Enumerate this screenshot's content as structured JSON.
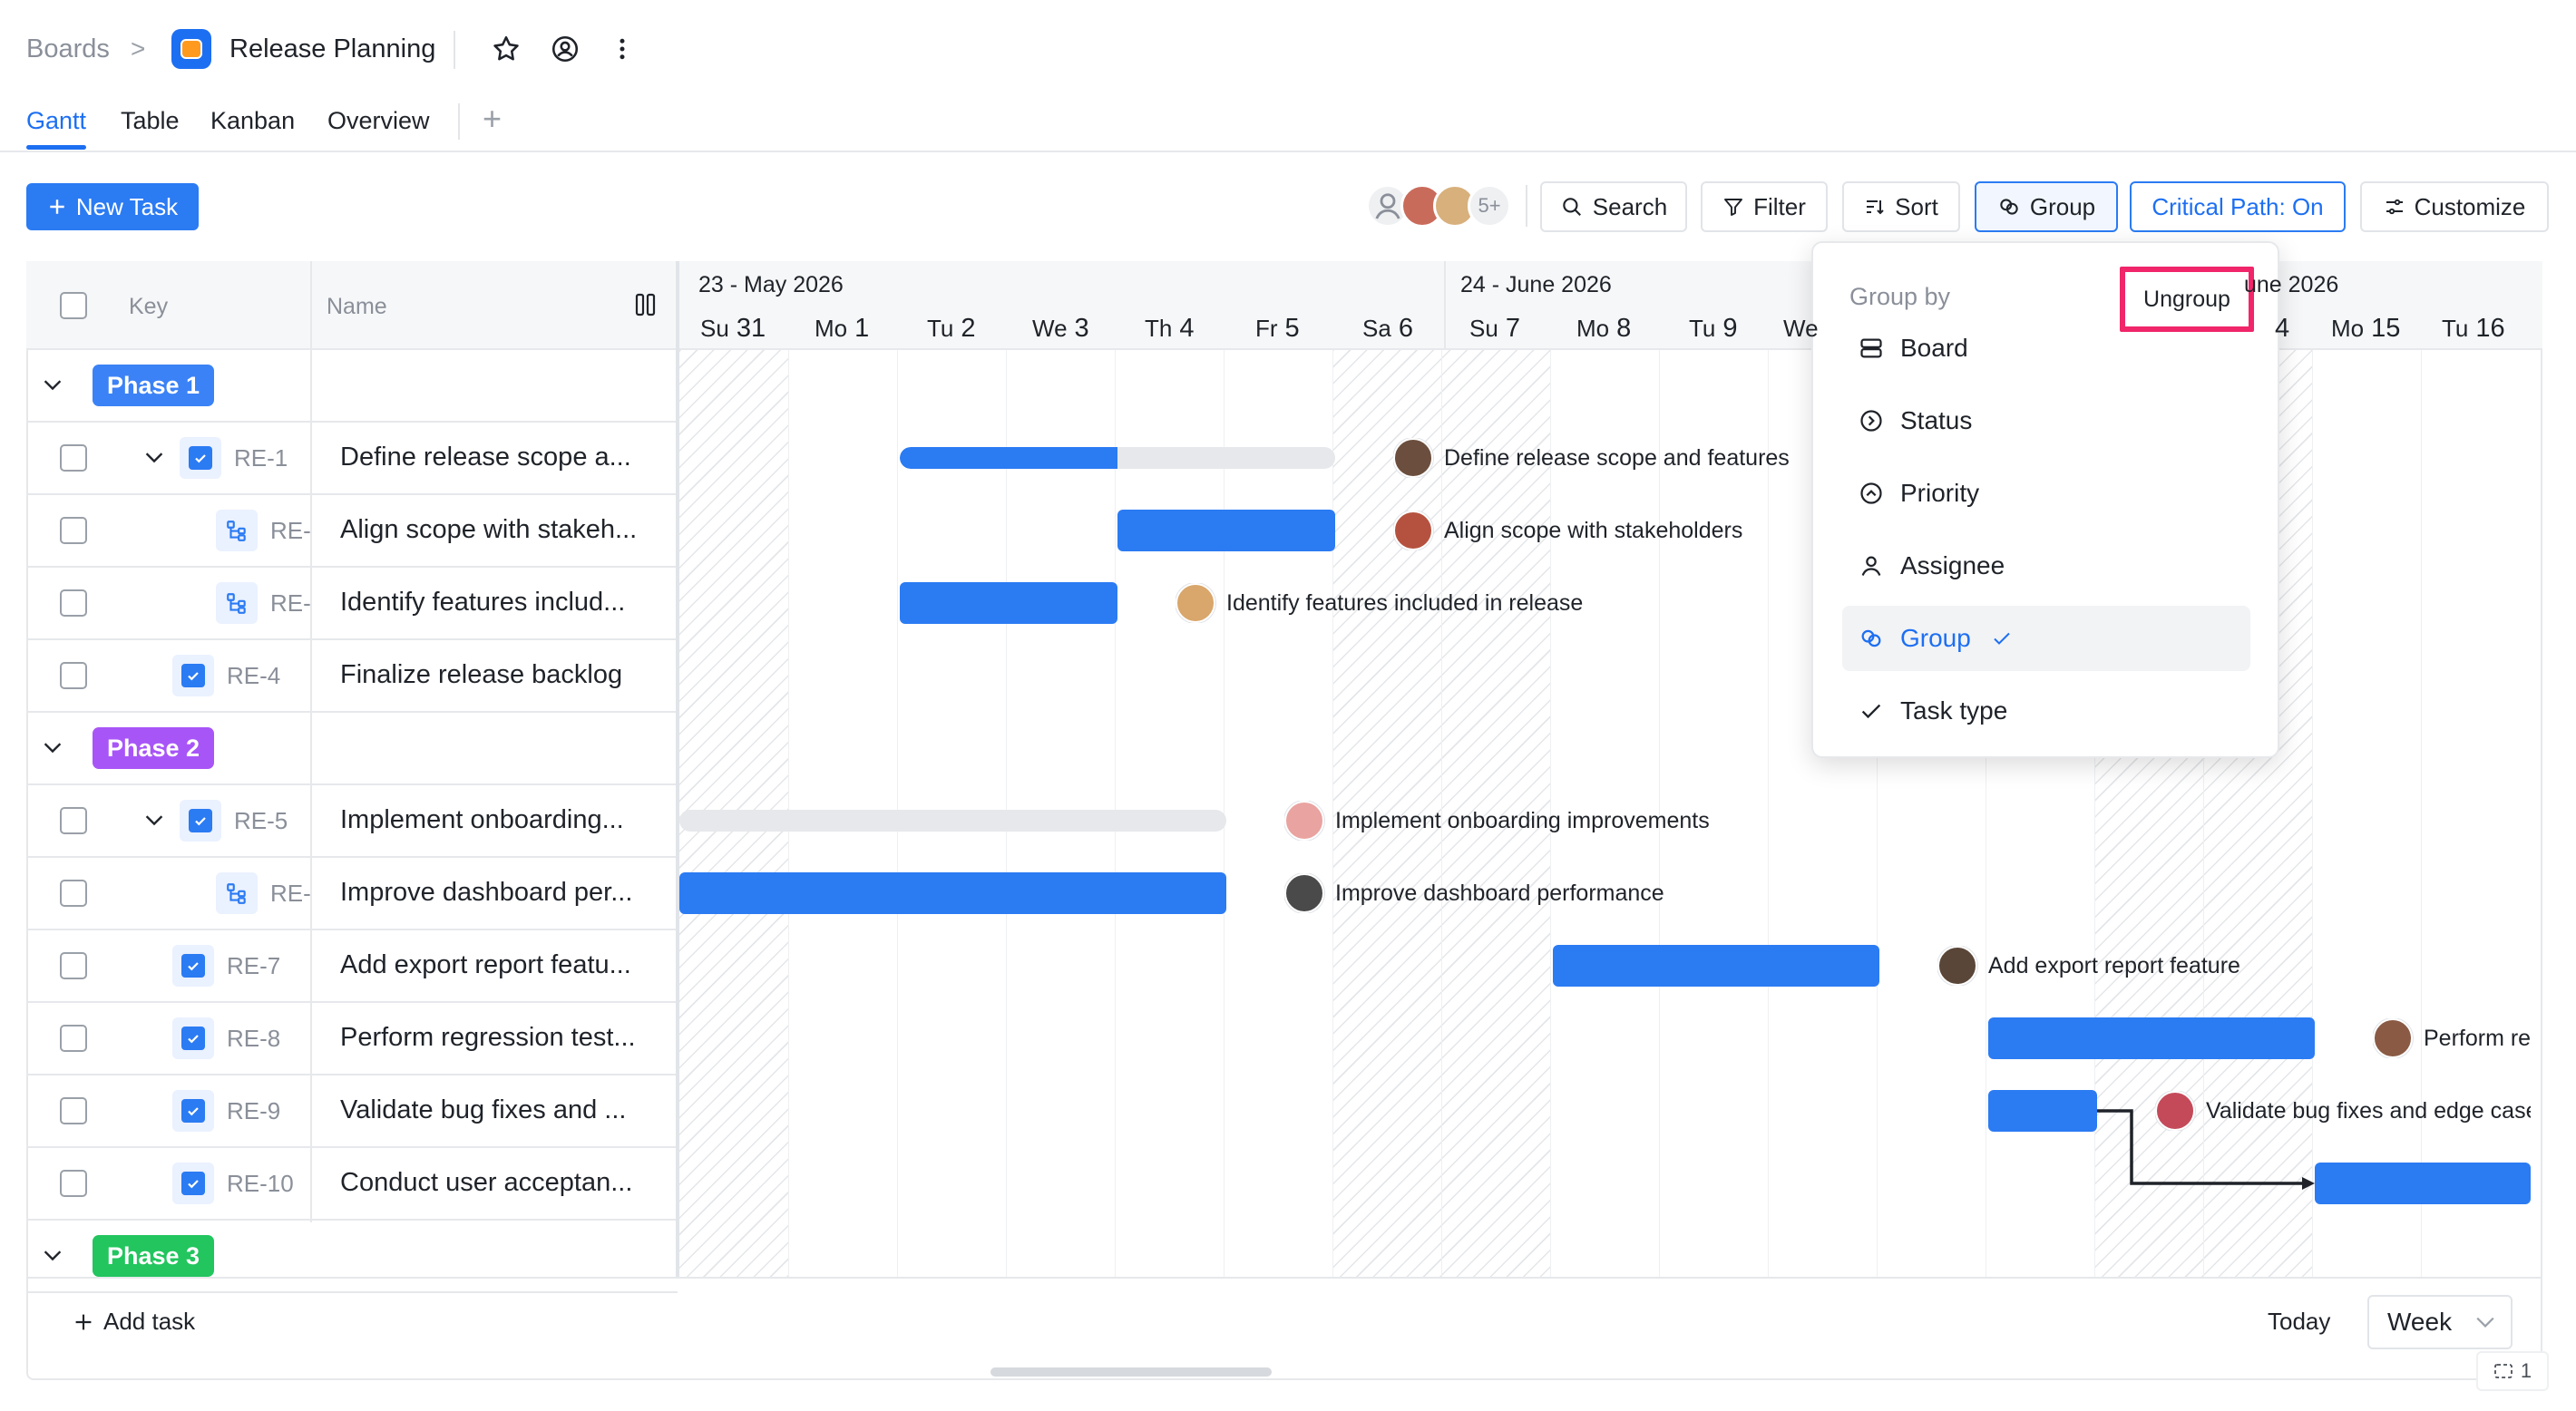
{
  "breadcrumb": {
    "root": "Boards",
    "separator": ">",
    "board_title": "Release Planning"
  },
  "tabs": [
    {
      "label": "Gantt",
      "active": true
    },
    {
      "label": "Table",
      "active": false
    },
    {
      "label": "Kanban",
      "active": false
    },
    {
      "label": "Overview",
      "active": false
    }
  ],
  "toolbar": {
    "new_task_label": "New Task",
    "avatars_more": "5+",
    "search_label": "Search",
    "filter_label": "Filter",
    "sort_label": "Sort",
    "group_label": "Group",
    "critical_path_label": "Critical Path: On",
    "customize_label": "Customize"
  },
  "table_header": {
    "key": "Key",
    "name": "Name"
  },
  "phases": [
    {
      "label": "Phase 1",
      "color": "#3b82f6"
    },
    {
      "label": "Phase 2",
      "color": "#a855f7"
    },
    {
      "label": "Phase 3",
      "color": "#22c55e"
    }
  ],
  "rows": [
    {
      "key": "RE-1",
      "name": "Define release scope a...",
      "bar_label": "Define release scope and features"
    },
    {
      "key": "RE-",
      "name": "Align scope with stakeh...",
      "bar_label": "Align scope with stakeholders"
    },
    {
      "key": "RE-",
      "name": "Identify features includ...",
      "bar_label": "Identify features included in release"
    },
    {
      "key": "RE-4",
      "name": "Finalize release backlog",
      "bar_label": ""
    },
    {
      "key": "RE-5",
      "name": "Implement onboarding...",
      "bar_label": "Implement onboarding improvements"
    },
    {
      "key": "RE-",
      "name": "Improve dashboard per...",
      "bar_label": "Improve dashboard performance"
    },
    {
      "key": "RE-7",
      "name": "Add export report featu...",
      "bar_label": "Add export report feature"
    },
    {
      "key": "RE-8",
      "name": "Perform regression test...",
      "bar_label": "Perform re"
    },
    {
      "key": "RE-9",
      "name": "Validate bug fixes and ...",
      "bar_label": "Validate bug fixes and edge case"
    },
    {
      "key": "RE-10",
      "name": "Conduct user acceptan...",
      "bar_label": ""
    }
  ],
  "timeline": {
    "weeks": [
      "23 - May 2026",
      "24 - June 2026",
      "une 2026"
    ],
    "days": [
      {
        "dow": "Su",
        "num": "31"
      },
      {
        "dow": "Mo",
        "num": "1"
      },
      {
        "dow": "Tu",
        "num": "2"
      },
      {
        "dow": "We",
        "num": "3"
      },
      {
        "dow": "Th",
        "num": "4"
      },
      {
        "dow": "Fr",
        "num": "5"
      },
      {
        "dow": "Sa",
        "num": "6"
      },
      {
        "dow": "Su",
        "num": "7"
      },
      {
        "dow": "Mo",
        "num": "8"
      },
      {
        "dow": "Tu",
        "num": "9"
      },
      {
        "dow": "We",
        "num": ""
      },
      {
        "dow": "",
        "num": "4"
      },
      {
        "dow": "Mo",
        "num": "15"
      },
      {
        "dow": "Tu",
        "num": "16"
      }
    ]
  },
  "footer": {
    "add_task": "Add task",
    "today": "Today",
    "zoom": "Week",
    "fit_count": "1"
  },
  "group_dropdown": {
    "title": "Group by",
    "ungroup": "Ungroup",
    "options": [
      {
        "label": "Board",
        "icon": "board-icon",
        "selected": false
      },
      {
        "label": "Status",
        "icon": "status-icon",
        "selected": false
      },
      {
        "label": "Priority",
        "icon": "priority-icon",
        "selected": false
      },
      {
        "label": "Assignee",
        "icon": "assignee-icon",
        "selected": false
      },
      {
        "label": "Group",
        "icon": "group-icon",
        "selected": true
      },
      {
        "label": "Task type",
        "icon": "check-icon",
        "selected": false
      }
    ]
  },
  "colors": {
    "accent": "#2b7bf3",
    "highlight": "#f0256a"
  }
}
